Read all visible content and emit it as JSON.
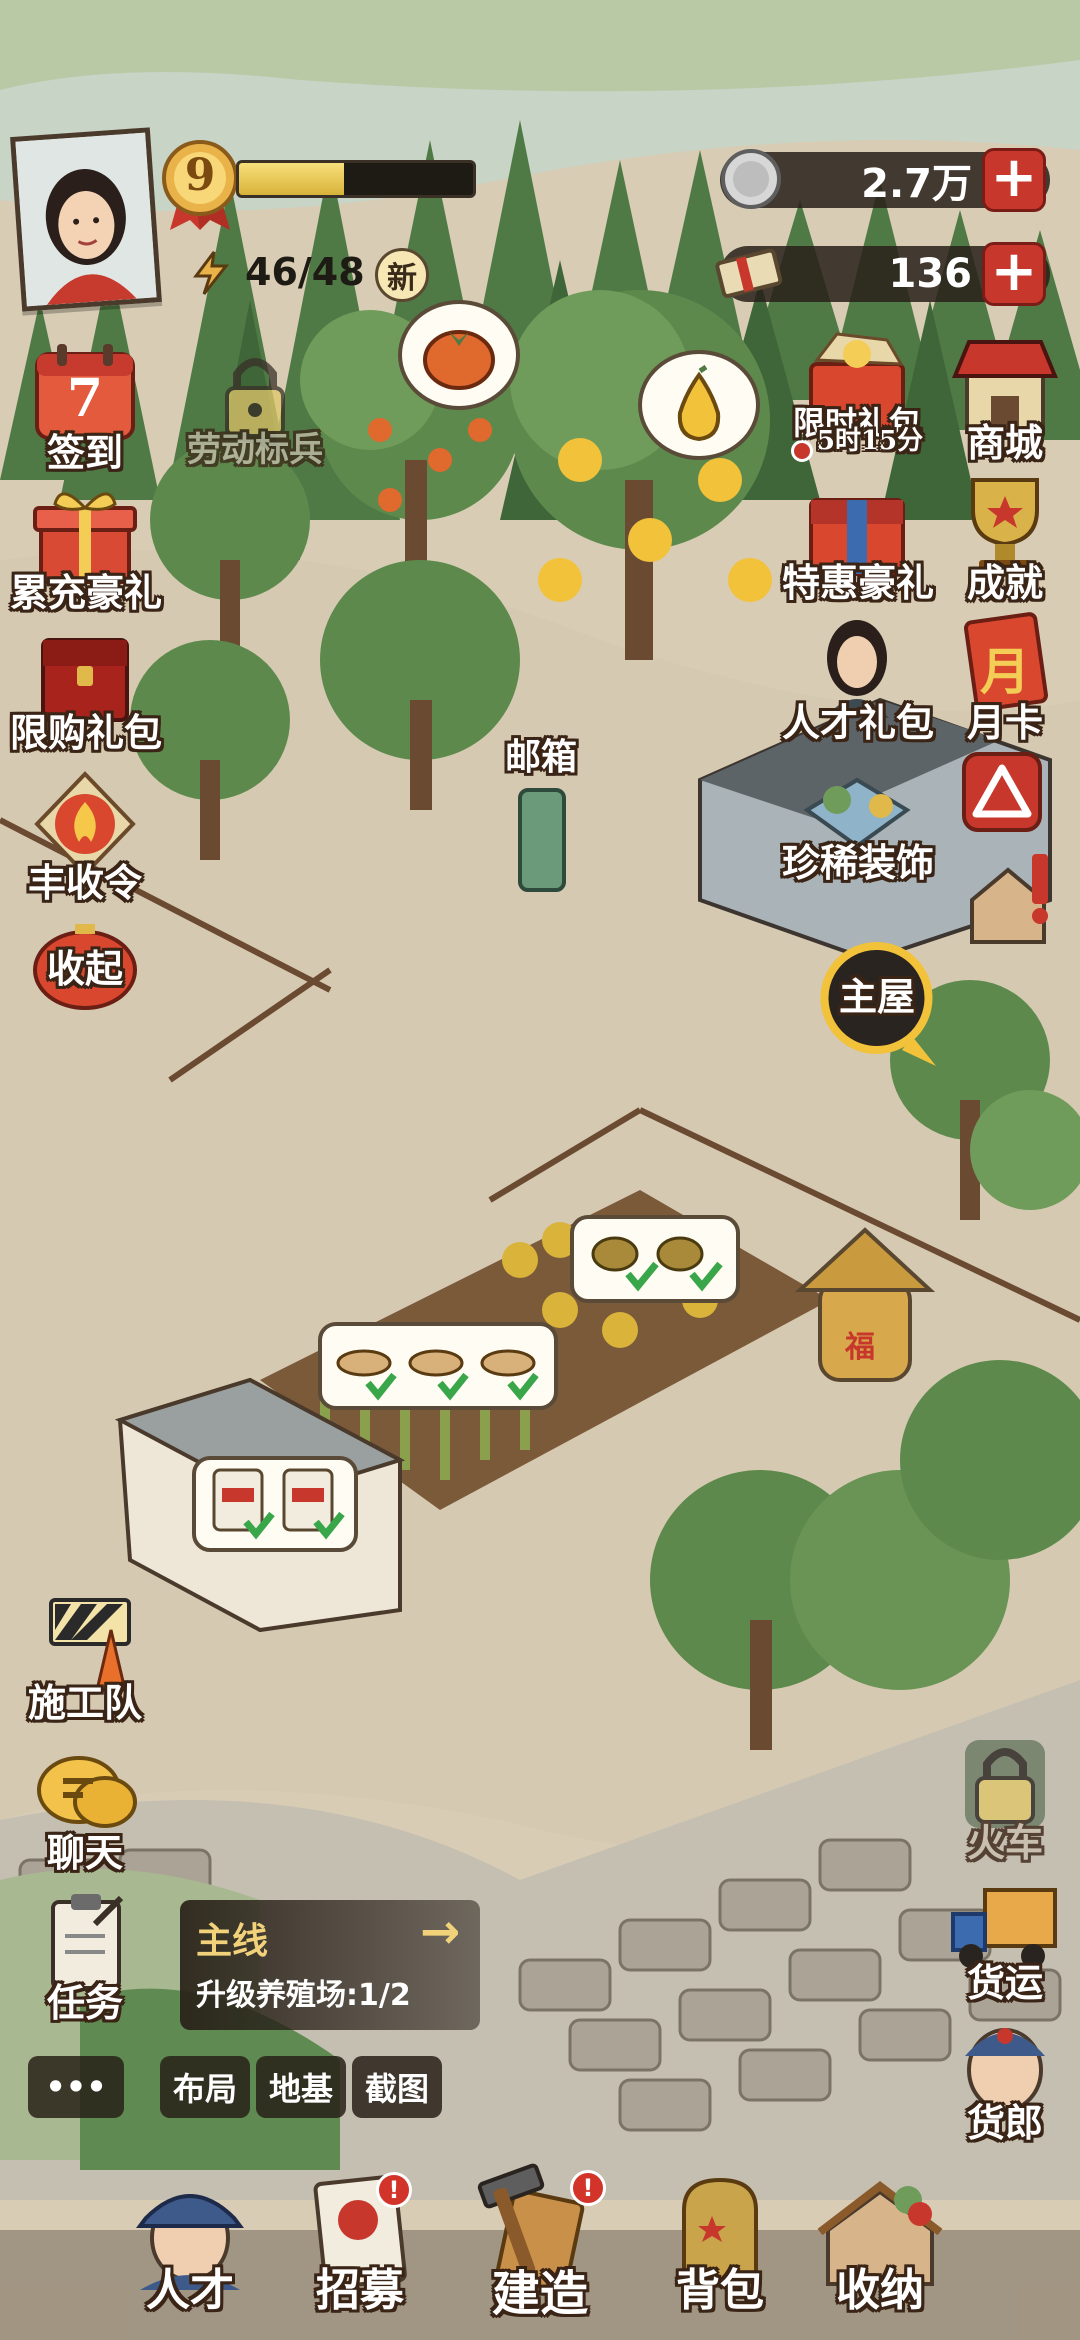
{
  "hud": {
    "level": "9",
    "xp_fraction": 0.45,
    "stamina": "46/48",
    "new_badge": "新",
    "coins": "2.7万",
    "tickets": "136",
    "plus": "+"
  },
  "left_menu": {
    "checkin_day": "7",
    "checkin": "签到",
    "locked_recruit": "劳动标兵",
    "recharge_gift": "累充豪礼",
    "limited_gift": "限购礼包",
    "harvest_order": "丰收令",
    "collapse": "收起",
    "construction_team": "施工队",
    "chat": "聊天",
    "tasks": "任务"
  },
  "right_menu": {
    "timed_gift": "限时礼包",
    "timed_gift_timer": "5时15分",
    "shop": "商城",
    "special_gift": "特惠豪礼",
    "achievement": "成就",
    "talent_gift": "人才礼包",
    "monthly_card": "月卡",
    "monthly_card_char": "月",
    "rare_decor": "珍稀装饰",
    "main_house": "主屋",
    "train_locked": "火车",
    "freight": "货运",
    "peddler": "货郎"
  },
  "map": {
    "mailbox": "邮箱",
    "granary": "福"
  },
  "quest": {
    "title": "主线",
    "arrow": "→",
    "desc": "升级养殖场:1/2"
  },
  "tools": {
    "more": "•••",
    "layout": "布局",
    "foundation": "地基",
    "screenshot": "截图"
  },
  "bottom_nav": {
    "talent": "人才",
    "recruit": "招募",
    "build": "建造",
    "backpack": "背包",
    "storage": "收纳",
    "alert": "!"
  }
}
